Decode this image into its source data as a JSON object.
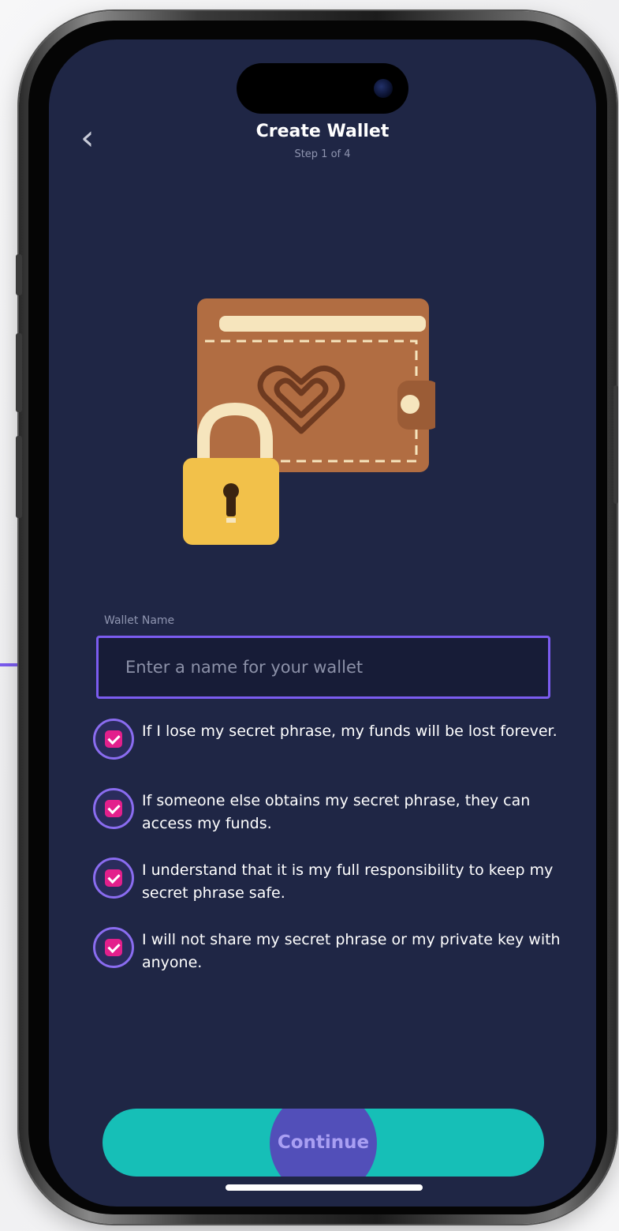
{
  "header": {
    "title": "Create Wallet",
    "step": "Step 1 of 4",
    "back_icon": "chevron-left-icon"
  },
  "illustration": {
    "description_icon": "wallet-with-padlock-icon"
  },
  "wallet_name": {
    "label": "Wallet Name",
    "placeholder": "Enter a name for your wallet",
    "value": ""
  },
  "acknowledgements": [
    {
      "text": "If I lose my secret phrase, my funds will be lost forever.",
      "checked": true
    },
    {
      "text": "If someone else obtains my secret phrase, they can access my funds.",
      "checked": true
    },
    {
      "text": "I understand that it is my full responsibility to keep my secret phrase safe.",
      "checked": true
    },
    {
      "text": "I will not share my secret phrase or my private key with anyone.",
      "checked": true
    }
  ],
  "actions": {
    "continue_label": "Continue"
  },
  "colors": {
    "screen_bg": "#1f2645",
    "accent_purple": "#7b5cf0",
    "checkbox_pink": "#e31f8c",
    "button_teal": "#16bfb7"
  }
}
